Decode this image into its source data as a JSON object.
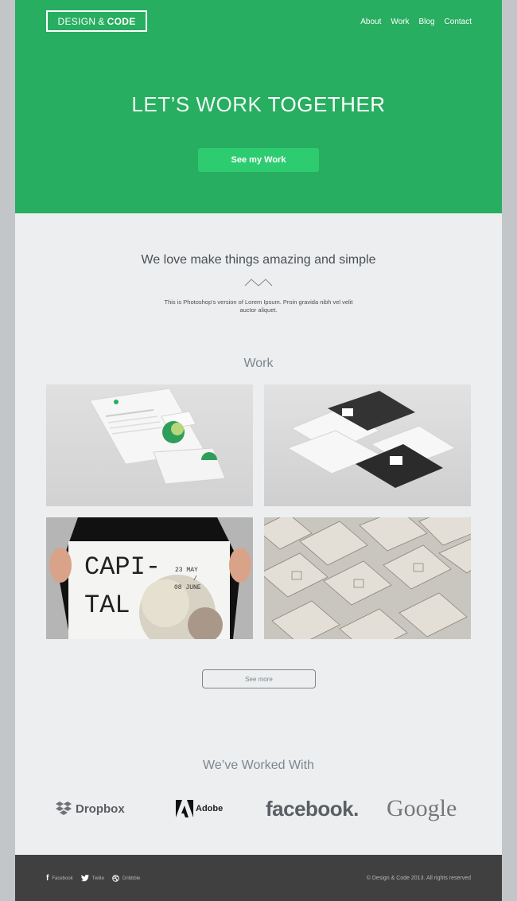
{
  "brand": {
    "part1": "DESIGN",
    "amp": "&",
    "part2": "CODE"
  },
  "nav": {
    "items": [
      "About",
      "Work",
      "Blog",
      "Contact"
    ]
  },
  "hero": {
    "title_light": "LET’S WORK",
    "title_bold": "TOGETHER",
    "button": "See my Work"
  },
  "intro": {
    "title": "We love make things amazing and simple",
    "text": "This is Photoshop's version  of Lorem Ipsum. Proin gravida nibh vel velit auctor aliquet."
  },
  "work": {
    "title": "Work",
    "poster": {
      "line1": "CAPI-",
      "line2": "TAL",
      "date1": "23 MAY",
      "slash": "/",
      "date2": "08 JUNE"
    },
    "see_more": "See more"
  },
  "clients": {
    "title": "We’ve Worked With",
    "logos": [
      "Dropbox",
      "Adobe",
      "facebook.",
      "Google"
    ]
  },
  "footer": {
    "social": [
      {
        "icon": "facebook-icon",
        "label": "Facebook"
      },
      {
        "icon": "twitter-icon",
        "label": "Twiite"
      },
      {
        "icon": "dribbble-icon",
        "label": "Dribbble"
      }
    ],
    "copyright": "© Design & Code 2013. All rights reserved"
  },
  "colors": {
    "accent": "#27ae60",
    "button": "#2ecc71",
    "footer": "#404040",
    "body": "#eceeef"
  }
}
